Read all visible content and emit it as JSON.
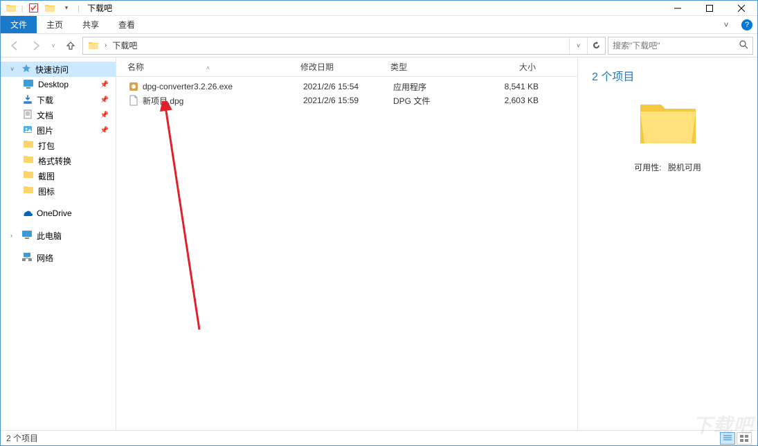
{
  "window": {
    "title": "下载吧"
  },
  "ribbon": {
    "file": "文件",
    "tabs": [
      "主页",
      "共享",
      "查看"
    ]
  },
  "nav": {
    "path_segment": "下载吧",
    "search_placeholder": "搜索\"下载吧\""
  },
  "sidebar": {
    "quick": {
      "label": "快速访问"
    },
    "items": [
      {
        "label": "Desktop",
        "pinned": true,
        "icon": "desktop"
      },
      {
        "label": "下载",
        "pinned": true,
        "icon": "downloads"
      },
      {
        "label": "文档",
        "pinned": true,
        "icon": "documents"
      },
      {
        "label": "图片",
        "pinned": true,
        "icon": "pictures"
      },
      {
        "label": "打包",
        "pinned": false,
        "icon": "folder"
      },
      {
        "label": "格式转换",
        "pinned": false,
        "icon": "folder"
      },
      {
        "label": "截图",
        "pinned": false,
        "icon": "folder"
      },
      {
        "label": "图标",
        "pinned": false,
        "icon": "folder"
      }
    ],
    "onedrive": "OneDrive",
    "thispc": "此电脑",
    "network": "网络"
  },
  "columns": {
    "name": "名称",
    "date": "修改日期",
    "type": "类型",
    "size": "大小"
  },
  "files": [
    {
      "name": "dpg-converter3.2.26.exe",
      "date": "2021/2/6 15:54",
      "type": "应用程序",
      "size": "8,541 KB",
      "icon": "exe"
    },
    {
      "name": "新项目.dpg",
      "date": "2021/2/6 15:59",
      "type": "DPG 文件",
      "size": "2,603 KB",
      "icon": "file"
    }
  ],
  "preview": {
    "title": "2 个项目",
    "status_label": "可用性:",
    "status_value": "脱机可用"
  },
  "statusbar": {
    "count": "2 个项目"
  },
  "watermark": "下载吧"
}
